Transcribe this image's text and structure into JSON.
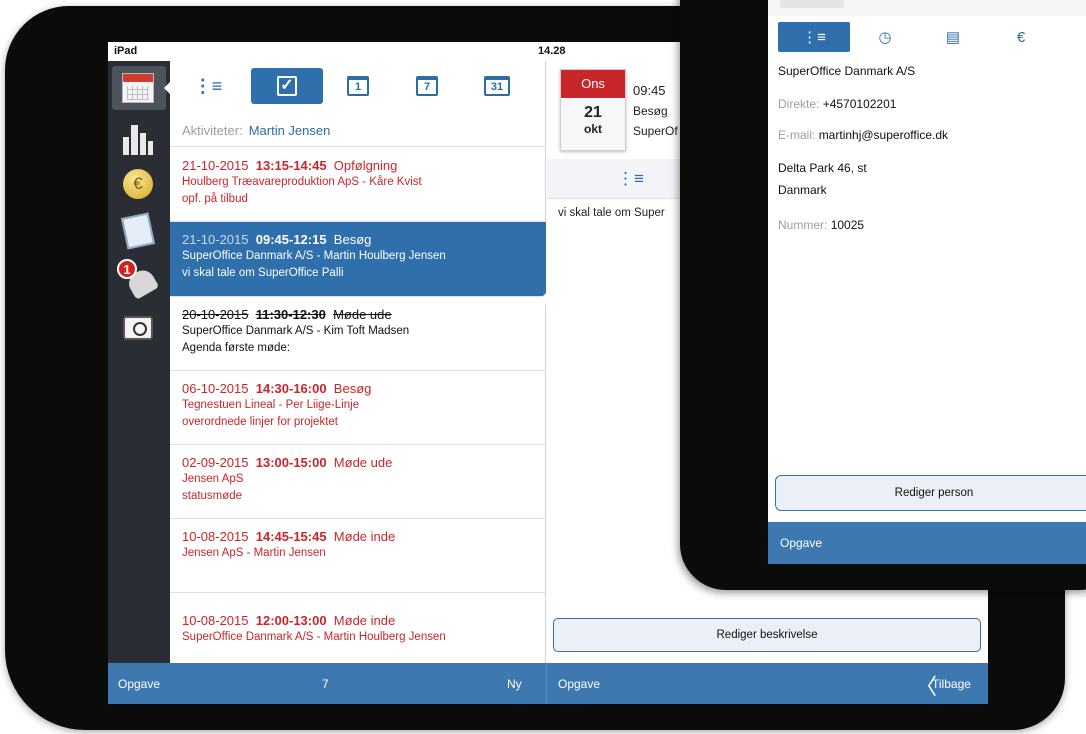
{
  "ipad": {
    "status": {
      "carrier": "iPad",
      "time": "14.28"
    },
    "list_header": {
      "label": "Aktiviteter:",
      "person": "Martin Jensen"
    },
    "activities": [
      {
        "date": "21-10-2015",
        "time": "13:15-14:45",
        "subject": "Opfølgning",
        "company_contact": "Houlberg Træavareproduktion ApS  -  Kåre Kvist",
        "description": "opf. på tilbud"
      },
      {
        "date": "21-10-2015",
        "time": "09:45-12:15",
        "subject": "Besøg",
        "company_contact": "SuperOffice Danmark A/S  -  Martin Houlberg Jensen",
        "description": "vi skal tale om SuperOffice Palli"
      },
      {
        "date": "20-10-2015",
        "time": "11:30-12:30",
        "subject": "Møde ude",
        "company_contact": "SuperOffice Danmark A/S  -  Kim Toft Madsen",
        "description": "Agenda første møde:"
      },
      {
        "date": "06-10-2015",
        "time": "14:30-16:00",
        "subject": "Besøg",
        "company_contact": "Tegnestuen Lineal  -  Per Liige-Linje",
        "description": "overordnede linjer for projektet"
      },
      {
        "date": "02-09-2015",
        "time": "13:00-15:00",
        "subject": "Møde ude",
        "company_contact": "Jensen ApS",
        "description": "statusmøde"
      },
      {
        "date": "10-08-2015",
        "time": "14:45-15:45",
        "subject": "Møde inde",
        "company_contact": "Jensen ApS  -  Martin Jensen",
        "description": ""
      },
      {
        "date": "10-08-2015",
        "time": "12:00-13:00",
        "subject": "Møde inde",
        "company_contact": "SuperOffice Danmark A/S  -  Martin Houlberg Jensen",
        "description": ""
      }
    ],
    "toolbar": {
      "day1": "1",
      "day7": "7",
      "day31": "31",
      "check": "✓"
    },
    "sidebar": {
      "badge_count": "1",
      "coin_symbol": "€"
    },
    "detail": {
      "weekday": "Ons",
      "day_num": "21",
      "month": "okt",
      "time": "09:45",
      "subject": "Besøg",
      "company": "SuperOf",
      "description": "vi skal tale om Super",
      "edit_button": "Rediger beskrivelse"
    },
    "bottom": {
      "left": "Opgave",
      "count": "7",
      "new": "Ny",
      "detail_left": "Opgave",
      "back": "Tilbage",
      "back_chevron": "〈"
    }
  },
  "iphone": {
    "top_caption": "",
    "company": "SuperOffice Danmark A/S",
    "phone_label": "Direkte:",
    "phone": "+4570102201",
    "email_label": "E-mail:",
    "email": "martinhj@superoffice.dk",
    "address1": "Delta Park 46, st",
    "country": "Danmark",
    "number_label": "Nummer:",
    "number": "10025",
    "edit_button": "Rediger person",
    "bottom_label": "Opgave"
  },
  "colors": {
    "accent": "#2f6fab",
    "bar": "#3d79b0",
    "red": "#c8262b",
    "sidebar": "#2a2e34"
  }
}
